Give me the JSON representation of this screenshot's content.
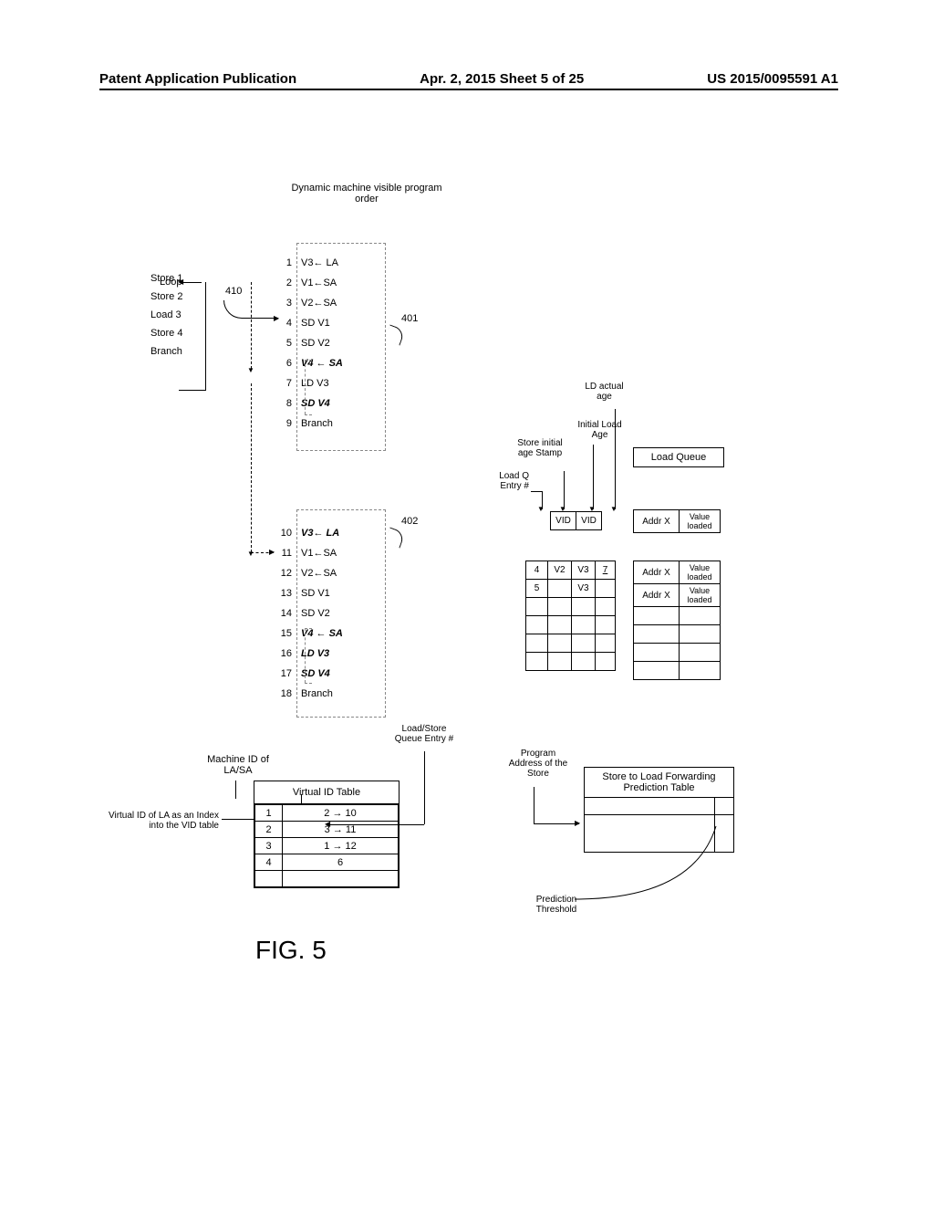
{
  "header": {
    "left": "Patent Application Publication",
    "center": "Apr. 2, 2015  Sheet 5 of 25",
    "right": "US 2015/0095591 A1"
  },
  "title": "Dynamic machine visible program order",
  "loopLabel": "Loop",
  "loopItems": [
    "Store 1",
    "Store 2",
    "Load 3",
    "Store 4",
    "Branch"
  ],
  "ref410": "410",
  "block1": [
    {
      "n": "1",
      "t": "V3← LA",
      "cls": ""
    },
    {
      "n": "2",
      "t": "V1←SA",
      "cls": ""
    },
    {
      "n": "3",
      "t": "V2←SA",
      "cls": ""
    },
    {
      "n": "4",
      "t": "SD V1",
      "cls": ""
    },
    {
      "n": "5",
      "t": "SD V2",
      "cls": ""
    },
    {
      "n": "6",
      "t": "V4 ← SA",
      "cls": "italic"
    },
    {
      "n": "7",
      "t": "LD V3",
      "cls": ""
    },
    {
      "n": "8",
      "t": "SD V4",
      "cls": "italic"
    },
    {
      "n": "9",
      "t": "Branch",
      "cls": ""
    }
  ],
  "ref401": "401",
  "block2": [
    {
      "n": "10",
      "t": "V3← LA",
      "cls": "italic"
    },
    {
      "n": "11",
      "t": "V1←SA",
      "cls": ""
    },
    {
      "n": "12",
      "t": "V2←SA",
      "cls": ""
    },
    {
      "n": "13",
      "t": "SD V1",
      "cls": ""
    },
    {
      "n": "14",
      "t": "SD V2",
      "cls": ""
    },
    {
      "n": "15",
      "t": "V4 ← SA",
      "cls": "italic"
    },
    {
      "n": "16",
      "t": "LD V3",
      "cls": "italic"
    },
    {
      "n": "17",
      "t": "SD V4",
      "cls": "italic"
    },
    {
      "n": "18",
      "t": "Branch",
      "cls": ""
    }
  ],
  "ref402": "402",
  "vidTableTitle": "Virtual ID Table",
  "vidLabelTop": "Machine ID of LA/SA",
  "vidLabelLeft": "Virtual ID of LA as an Index into the VID table",
  "vidLabelRight": "Load/Store Queue Entry #",
  "vidRows": [
    [
      "1",
      "2 → 10"
    ],
    [
      "2",
      "3 → 11"
    ],
    [
      "3",
      "1 → 12"
    ],
    [
      "4",
      "6"
    ]
  ],
  "lq": {
    "entryNum": "Load Q Entry #",
    "storeStamp": "Store initial age Stamp",
    "initialLoad": "Initial Load Age",
    "ldActual": "LD actual age",
    "queueTitle": "Load Queue",
    "vid": "VID",
    "addr": "Addr X",
    "valueLoaded": "Value loaded",
    "row1": {
      "a": "4",
      "b": "V2",
      "c": "V3",
      "d": "7",
      "addr": "Addr X",
      "val": "Value loaded"
    },
    "row2": {
      "a": "5",
      "b": "",
      "c": "V3",
      "d": "",
      "addr": "Addr X",
      "val": "Value loaded"
    },
    "rowTop": {
      "addr": "Addr X",
      "val": "Value loaded"
    }
  },
  "stl": {
    "leftLabel": "Program Address of the Store",
    "title": "Store to Load Forwarding Prediction Table",
    "threshold": "Prediction Threshold"
  },
  "figLabel": "FIG. 5"
}
